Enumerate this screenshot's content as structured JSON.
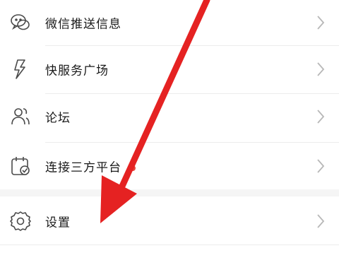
{
  "menu": {
    "items": [
      {
        "label": "微信推送信息",
        "icon": "wechat-icon"
      },
      {
        "label": "快服务广场",
        "icon": "lightning-icon"
      },
      {
        "label": "论坛",
        "icon": "users-icon"
      },
      {
        "label": "连接三方平台",
        "icon": "calendar-check-icon"
      },
      {
        "label": "设置",
        "icon": "gear-icon"
      }
    ]
  },
  "colors": {
    "arrow": "#e52222",
    "badge_dot": "#e8453c",
    "text": "#1a1a1a",
    "icon_stroke": "#4a4a4a",
    "chevron": "#b8b8b8"
  }
}
